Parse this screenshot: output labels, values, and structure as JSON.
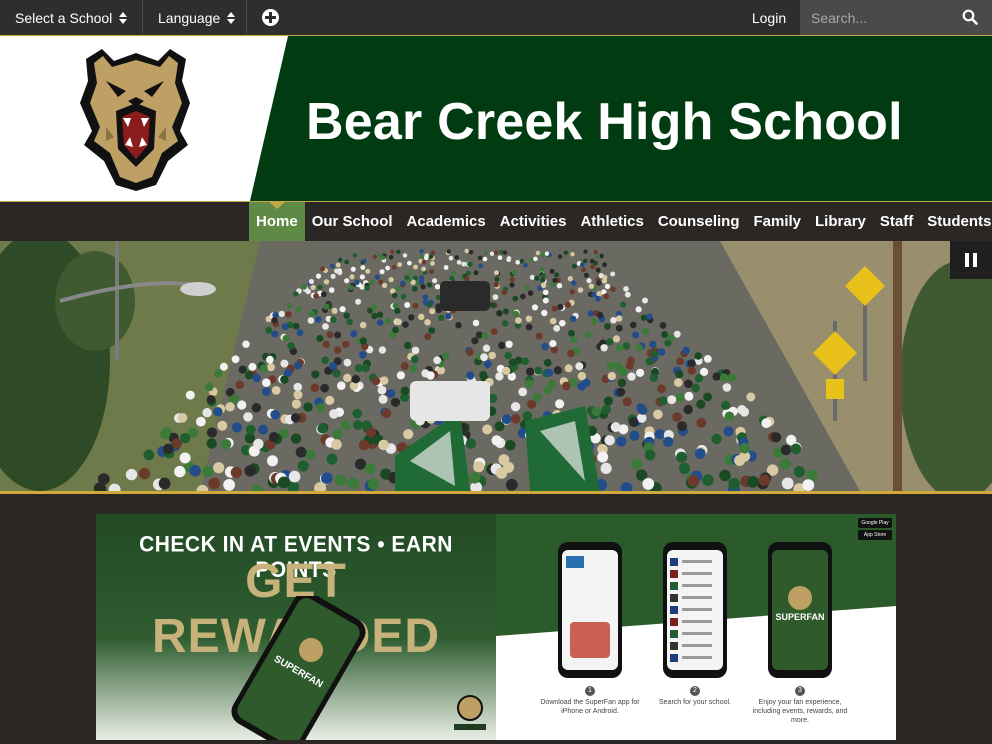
{
  "topbar": {
    "select_school": "Select a School",
    "language": "Language",
    "login": "Login",
    "search_placeholder": "Search..."
  },
  "header": {
    "school_name": "Bear Creek High School"
  },
  "nav": {
    "items": [
      "Home",
      "Our School",
      "Academics",
      "Activities",
      "Athletics",
      "Counseling",
      "Family",
      "Library",
      "Staff",
      "Students"
    ],
    "active": "Home"
  },
  "banner": {
    "line1": "CHECK IN AT EVENTS • EARN POINTS",
    "line2": "GET REWARDED",
    "steps": [
      {
        "num": "1",
        "text": "Download the SuperFan app for iPhone or Android."
      },
      {
        "num": "2",
        "text": "Search for your school."
      },
      {
        "num": "3",
        "text": "Enjoy your fan experience, including events, rewards, and more."
      }
    ],
    "app_name": "SUPERFAN",
    "store_badges": [
      "Google Play",
      "App Store"
    ]
  },
  "colors": {
    "topbar": "#2e2e2e",
    "header_green": "#003b12",
    "gold": "#c7a648",
    "nav_active": "#5f8a45",
    "nav_bg": "#2b2725"
  },
  "icons": {
    "select_school": "updown-caret-icon",
    "language": "updown-caret-icon",
    "add": "plus-circle-icon",
    "search": "search-icon",
    "slideshow": "pause-icon"
  }
}
